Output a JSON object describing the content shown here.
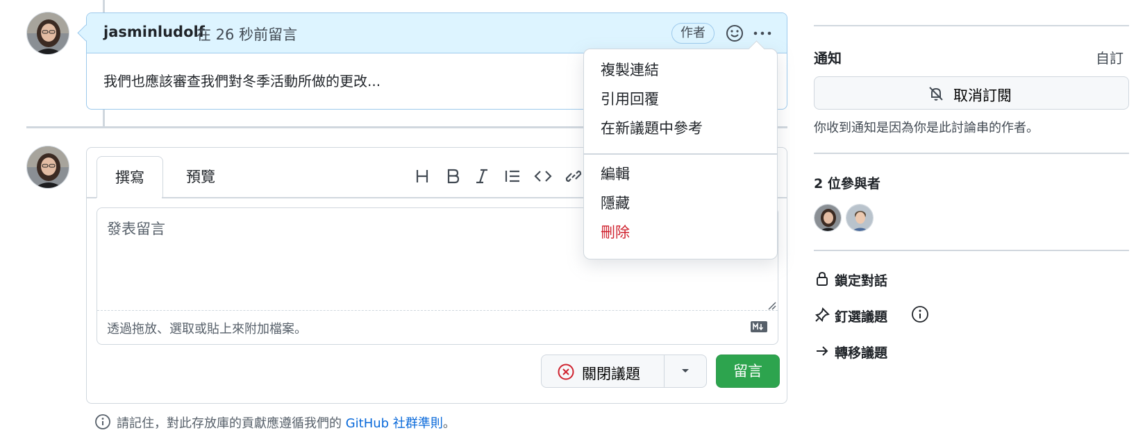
{
  "comment": {
    "author": "jasminludolf",
    "time": "在 26 秒前留言",
    "badge": "作者",
    "body": "我們也應該審查我們對冬季活動所做的更改..."
  },
  "menu": {
    "items": [
      "複製連結",
      "引用回覆",
      "在新議題中參考",
      "編輯",
      "隱藏",
      "刪除"
    ]
  },
  "compose": {
    "tabs": [
      "撰寫",
      "預覽"
    ],
    "placeholder": "發表留言",
    "attach_hint": "透過拖放、選取或貼上來附加檔案。",
    "close_issue_label": "關閉議題",
    "comment_label": "留言"
  },
  "guideline": {
    "text_before": "請記住，對此存放庫的貢獻應遵循我們的 ",
    "link": "GitHub 社群準則",
    "text_after": "。"
  },
  "sidebar": {
    "notifications_title": "通知",
    "customize": "自訂",
    "unsubscribe": "取消訂閱",
    "reason": "你收到通知是因為你是此討論串的作者。",
    "participants_title": "2 位參與者",
    "actions": [
      "鎖定對話",
      "釘選議題",
      "轉移議題"
    ]
  },
  "colors": {
    "accent": "#0969da",
    "header_bg": "#ddf4ff",
    "danger": "#cf222e",
    "primary_button": "#2da44e"
  }
}
